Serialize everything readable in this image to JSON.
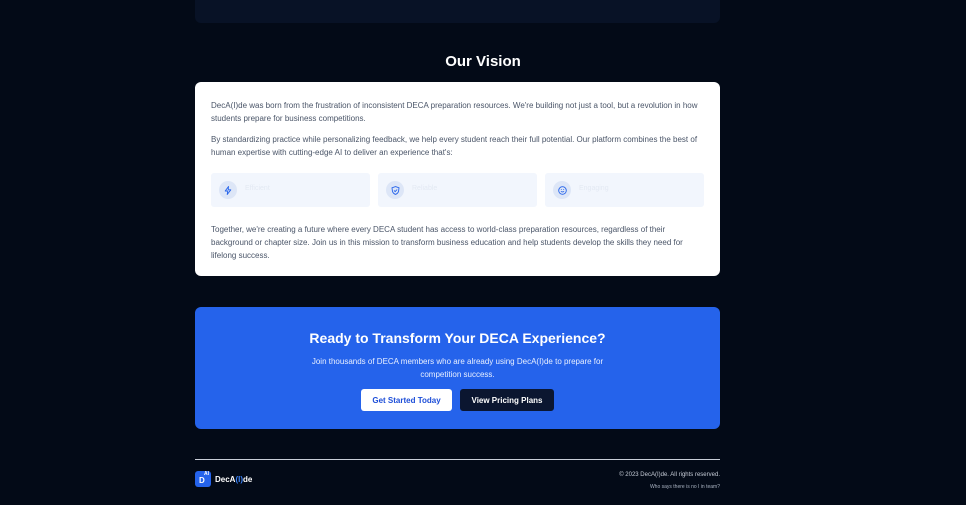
{
  "vision": {
    "title": "Our Vision",
    "paragraph1": "DecA(I)de was born from the frustration of inconsistent DECA preparation resources. We're building not just a tool, but a revolution in how students prepare for business competitions.",
    "paragraph2": "By standardizing practice while personalizing feedback, we help every student reach their full potential. Our platform combines the best of human expertise with cutting-edge AI to deliver an experience that's:",
    "features": [
      {
        "icon": "lightning-icon",
        "label": "Efficient"
      },
      {
        "icon": "shield-icon",
        "label": "Reliable"
      },
      {
        "icon": "smile-icon",
        "label": "Engaging"
      }
    ],
    "paragraph3": "Together, we're creating a future where every DECA student has access to world-class preparation resources, regardless of their background or chapter size. Join us in this mission to transform business education and help students develop the skills they need for lifelong success."
  },
  "cta": {
    "title": "Ready to Transform Your DECA Experience?",
    "subtitle": "Join thousands of DECA members who are already using DecA(I)de to prepare for competition success.",
    "primary_button": "Get Started Today",
    "secondary_button": "View Pricing Plans"
  },
  "footer": {
    "logo_badge_letter": "D",
    "logo_badge_sup": "AI",
    "logo_prefix": "DecA",
    "logo_highlight": "(I)",
    "logo_suffix": "de",
    "copyright": "© 2023 DecA(I)de. All rights reserved.",
    "tagline": "Who says there is no I in team?"
  },
  "colors": {
    "background": "#030a17",
    "accent": "#2563eb",
    "card": "#ffffff"
  }
}
